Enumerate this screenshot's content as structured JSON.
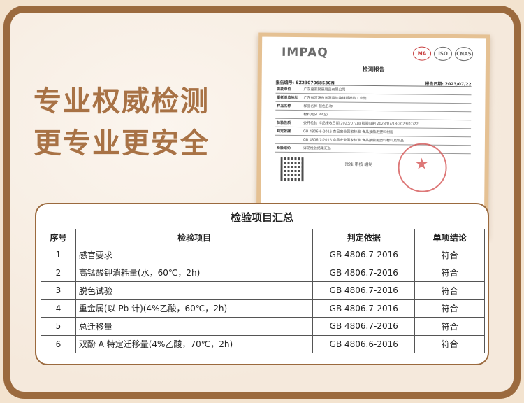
{
  "headline": {
    "line1": "专业权威检测",
    "line2": "更专业更安全"
  },
  "certificate": {
    "logo": "IMPAQ",
    "marks": [
      "MA",
      "ISO",
      "CNAS"
    ],
    "title": "检测报告",
    "report_no": "报告编号: SZ230706853CN",
    "report_date": "报告日期: 2023/07/22",
    "rows": [
      {
        "h": "委托单位",
        "v": "广东皇家聚康用品有限公司"
      },
      {
        "h": "委托单位地址",
        "v": "广东省河源市东源县仙塘镇蝴蝶岭工业园"
      },
      {
        "h": "样品名称",
        "v": "样品名称    颜色名称"
      },
      {
        "h": "",
        "v": "材料成分    PP(5)"
      },
      {
        "h": "检验性质",
        "v": "委托检验    样品接收日期 2023/07/18  检验日期 2023/07/18-2023/07/22"
      },
      {
        "h": "判定依据",
        "v": "GB 4806.6-2016  食品安全国家标准 食品接触用塑料树脂"
      },
      {
        "h": "",
        "v": "GB 4806.7-2016  食品安全国家标准 食品接触用塑料材料及制品"
      },
      {
        "h": "检验结论",
        "v": "详见检验结果汇总"
      }
    ],
    "signature": "批准  审核  编制"
  },
  "summary": {
    "title": "检验项目汇总",
    "headers": [
      "序号",
      "检验项目",
      "判定依据",
      "单项结论"
    ],
    "rows": [
      {
        "no": "1",
        "item": "感官要求",
        "basis": "GB 4806.7-2016",
        "result": "符合"
      },
      {
        "no": "2",
        "item": "高锰酸钾消耗量(水，60℃，2h)",
        "basis": "GB 4806.7-2016",
        "result": "符合"
      },
      {
        "no": "3",
        "item": "脱色试验",
        "basis": "GB 4806.7-2016",
        "result": "符合"
      },
      {
        "no": "4",
        "item": "重金属(以 Pb 计)(4%乙酸，60℃，2h)",
        "basis": "GB 4806.7-2016",
        "result": "符合"
      },
      {
        "no": "5",
        "item": "总迁移量",
        "basis": "GB 4806.7-2016",
        "result": "符合"
      },
      {
        "no": "6",
        "item": "双酚 A 特定迁移量(4%乙酸，70℃，2h)",
        "basis": "GB 4806.6-2016",
        "result": "符合"
      }
    ]
  },
  "colors": {
    "frame": "#9b6a3e",
    "headline": "#a87245",
    "background": "#f3e3cf"
  }
}
